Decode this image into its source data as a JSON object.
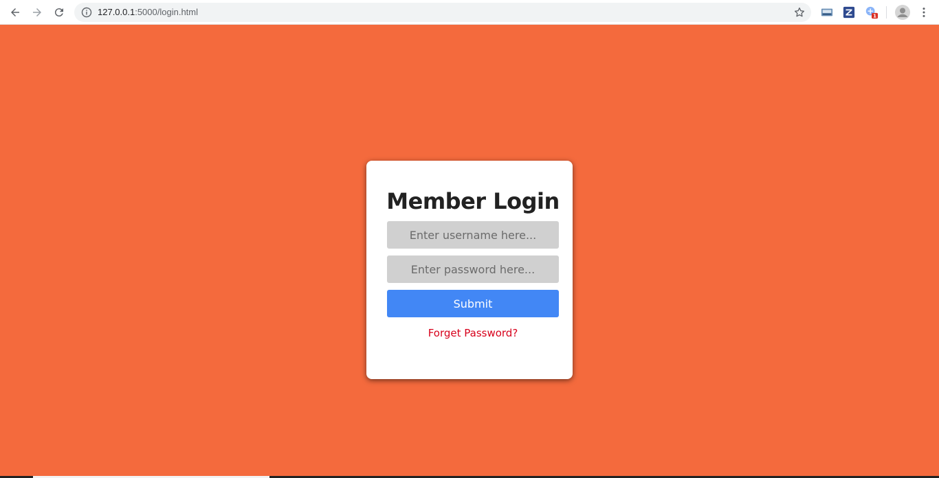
{
  "browser": {
    "url_host": "127.0.0.1",
    "url_rest": ":5000/login.html",
    "icons": [
      "back-icon",
      "forward-icon",
      "reload-icon",
      "info-icon",
      "star-icon",
      "profile-icon",
      "menu-icon"
    ],
    "extension_badge": "1"
  },
  "login": {
    "title": "Member Login",
    "username_placeholder": "Enter username here...",
    "password_placeholder": "Enter password here...",
    "submit_label": "Submit",
    "forgot_label": "Forget Password?"
  },
  "colors": {
    "background": "#f46a3d",
    "submit": "#4287f5",
    "forgot_link": "#d7001b",
    "field": "#d0d0d0"
  }
}
